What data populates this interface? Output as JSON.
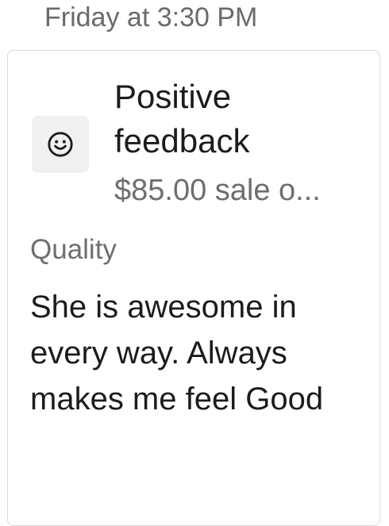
{
  "timestamp": "Friday at 3:30 PM",
  "feedback": {
    "icon": "smiley-face-icon",
    "title": "Positive feedback",
    "subtitle": "$85.00 sale o...",
    "category": "Quality",
    "comment": "She is awesome in every way. Always makes me feel Good"
  }
}
